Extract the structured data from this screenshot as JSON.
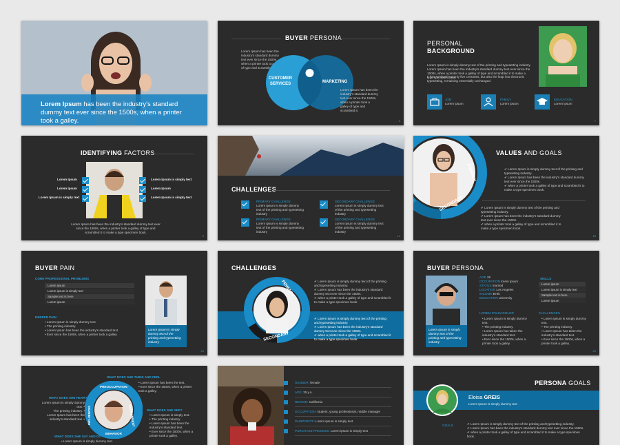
{
  "slide1": {
    "caption_bold": "Lorem Ipsum",
    "caption_rest": " has been the industry's standard dummy text ever since the 1500s, when a printer took a galley."
  },
  "slide2": {
    "title_a": "BUYER ",
    "title_b": "PERSONA",
    "left_text": "Lorem Ipsum has been the industry's standard dummy text ever since the 1500s, when a printer took a galley of type and scrambled it.",
    "circle_left": "CUSTOMER SERVICES",
    "circle_right": "MARKETING",
    "right_text": "Lorem Ipsum has been the industry's standard dummy text ever since the 1500s, when a printer took a galley of type and scrambled it.",
    "page": "3"
  },
  "slide3": {
    "title_line1": "PERSONAL",
    "title_line2": "BACKGROUND",
    "body1": "Lorem Ipsum is simply dummy text of the printing and typesetting industry. Lorem Ipsum has been the industry's standard dummy text ever since the 1500s, when a printer took a galley of type and scrambled it to make a type specimen book.",
    "body2": "It has survived not only five centuries, but also the leap into electronic typesetting, remaining essentially unchanged.",
    "items": [
      {
        "label": "JOB",
        "value": "Lorem ipsum"
      },
      {
        "label": "FAMILY",
        "value": "Lorem ipsum"
      },
      {
        "label": "EDUCATION",
        "value": "Lorem ipsum"
      }
    ],
    "page": "7"
  },
  "slide4": {
    "title_a": "IDENTIFYING ",
    "title_b": "FACTORS",
    "left_items": [
      "Lorem Ipsum",
      "Lorem Ipsum",
      "Lorem Ipsum is simply text"
    ],
    "right_items": [
      "Lorem Ipsum is simply text",
      "Lorem Ipsum",
      "Lorem Ipsum is simply text"
    ],
    "footer": "Lorem Ipsum has been the industry's standard dummy text ever since the 1500s, when a printer took a galley of type and scrambled it to make a type specimen book.",
    "page": "9"
  },
  "slide5": {
    "title": "CHALLENGES",
    "items": [
      {
        "title": "PRIMARY CHALLENGE",
        "text": "Lorem Ipsum is simply dummy text of the printing and typesetting industry"
      },
      {
        "title": "SECONDARY CHALLENGE",
        "text": "Lorem Ipsum is simply dummy text of the printing and typesetting industry"
      },
      {
        "title": "PRIMARY CHALLENGE",
        "text": "Lorem Ipsum is simply dummy text of the printing and typesetting industry"
      },
      {
        "title": "SECONDARY CHALLENGE",
        "text": "Lorem Ipsum is simply dummy text of the printing and typesetting industry"
      }
    ],
    "page": "14"
  },
  "slide6": {
    "title_a": "VALUES ",
    "title_b": "AND GOALS",
    "arc_primary": "PRIMARY",
    "arc_secondary": "SECONDARY",
    "top_bullets": [
      "Lorem Ipsum is simply dummy text of the printing and typesetting industry.",
      "Lorem Ipsum has been the industry's standard dummy text ever since the 1500s.",
      "when a printer took a galley of type and scrambled it to make a type specimen book."
    ],
    "bottom_bullets": [
      "Lorem Ipsum is simply dummy text of the printing and typesetting industry.",
      "Lorem Ipsum has been the industry's standard dummy text ever since the 1500s.",
      "when a printer took a galley of type and scrambled it to make a type specimen book."
    ],
    "page": "16"
  },
  "slide7": {
    "title_a": "BUYER ",
    "title_b": "PAIN",
    "section1": "CORE PROFESSIONAL PROBLEMS",
    "rows": [
      "Lorem ipsum",
      "Lorem ipsum is simply text",
      "Sample text is here",
      "Lorem ipsum"
    ],
    "section2": "DEEPER PAIN",
    "bullets": [
      "Lorem Ipsum is simply dummy text.",
      "The printing industry.",
      "Lorem Ipsum has been the industry's standard text.",
      "Ever since the 1500s, when a printer took a galley."
    ],
    "photo_caption": "Lorem Ipsum is simply dummy text of the printing and typesetting industry",
    "page": "20"
  },
  "slide8": {
    "title": "CHALLENGES",
    "arc_primary": "PRIMARY",
    "arc_secondary": "SECONDARY",
    "top_bullets": [
      "Lorem Ipsum is simply dummy text of the printing and typesetting industry.",
      "Lorem Ipsum has been the industry's standard dummy text ever since the 1500s.",
      "when a printer took a galley of type and scrambled it to make a type specimen book."
    ],
    "bottom_bullets": [
      "Lorem Ipsum is simply dummy text of the printing and typesetting industry.",
      "Lorem Ipsum has been the industry's standard dummy text ever since the 1500s.",
      "when a printer took a galley of type and scrambled it to make a type specimen book."
    ]
  },
  "slide9": {
    "title_a": "BUYER ",
    "title_b": "PERSONA",
    "fields": [
      {
        "label": "AGE",
        "value": " 25"
      },
      {
        "label": "OCCUPATION",
        "value": " lorem ipsum"
      },
      {
        "label": "STATUS",
        "value": " married"
      },
      {
        "label": "LOCATION",
        "value": " Los Angeles"
      },
      {
        "label": "INCOME",
        "value": " $75k"
      },
      {
        "label": "EDUCATION",
        "value": " university"
      }
    ],
    "quote": "Lorem Ipsum is simply dummy text of the printing and typesetting industry. Lorem Ipsum has been the industry's standard dummy text ever since the 1500s.",
    "skills_title": "SKILLS",
    "skills": [
      "Lorem ipsum",
      "Lorem ipsum is simply text",
      "Sample text is here",
      "Lorem ipsum"
    ],
    "left_section": "LOREM IPSUM DOLOR",
    "left_bullets": [
      "Lorem Ipsum is simply dummy text.",
      "The printing industry.",
      "Lorem Ipsum has taken the industry's standard text.",
      "Ever since the 1500s, when a printer took a galley."
    ],
    "right_section": "CHALLENGES",
    "right_bullets": [
      "Lorem Ipsum is simply dummy text.",
      "The printing industry.",
      "Lorem Ipsum has taken the industry's standard text.",
      "Ever since the 1500s, when a printer took a galley."
    ],
    "photo_caption": "Lorem Ipsum is simply dummy text of the printing and typesetting industry",
    "page": "29"
  },
  "slide10": {
    "top_label": "WHAT DOES SHE THINK AND FEEL",
    "ring": [
      "PREOCCUPATION",
      "ENVIRONMENT",
      "BEHAVIOR",
      "INFLUENCES"
    ],
    "left_label": "WHAT DOES SHE HEAR?",
    "right_label": "WHAT DOES SHE SEE?",
    "bottom_label": "WHAT DOES SHE SAY AND DO",
    "top_bullets": [
      "Lorem Ipsum has been the text.",
      "Ever since the 1500s, when a printer took a galley."
    ],
    "left_bullets": [
      "Lorem Ipsum is simply dummy text.",
      "The printing industry.",
      "Lorem Ipsum has been the industry's standard text."
    ],
    "right_bullets": [
      "Lorem Ipsum is simply text.",
      "The printing industry.",
      "Lorem Ipsum has been the industry's standard text.",
      "Ever since the 1500s, when a printer took a galley."
    ],
    "bottom_bullets": [
      "Lorem Ipsum is simply dummy text."
    ]
  },
  "slide11": {
    "fields": [
      {
        "label": "GENDER:",
        "value": " female"
      },
      {
        "label": "AGE:",
        "value": " 25 y.o."
      },
      {
        "label": "REGION:",
        "value": " California"
      },
      {
        "label": "OCCUPATION:",
        "value": " student, young professional, middle manager"
      },
      {
        "label": "PAINPOINTS:",
        "value": " Lorem ipsum is simply text"
      },
      {
        "label": "PURCHASE PROCESS:",
        "value": " Lorem ipsum is simply text"
      }
    ]
  },
  "slide12": {
    "title_a": "PERSONA ",
    "title_b": "GOALS",
    "name_a": "Eloisa ",
    "name_b": "GREIS",
    "subtitle": "Lorem Ipsum is simply dummy text",
    "section": "GOALS",
    "bullets": [
      "Lorem Ipsum is simply dummy text of the printing and typesetting industry.",
      "Lorem Ipsum has been the industry's standard dummy text ever since the 1500s.",
      "when a printer took a galley of type and scrambled it to make a type specimen book."
    ]
  }
}
